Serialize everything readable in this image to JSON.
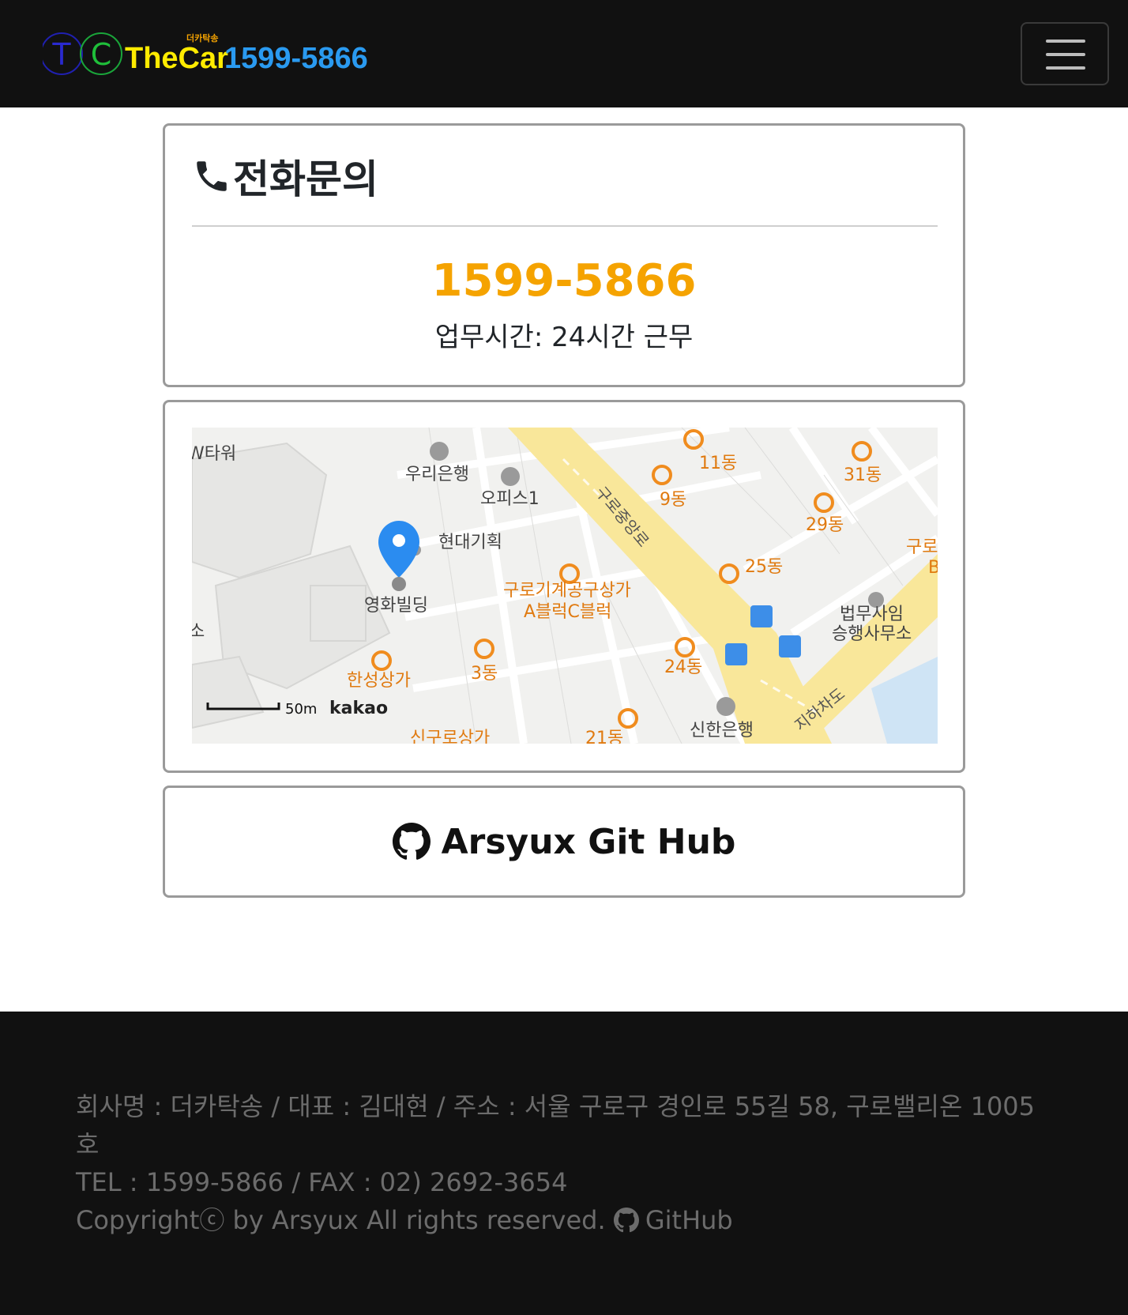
{
  "header": {
    "logo_letter_t": "T",
    "logo_letter_c": "C",
    "logo_small": "더카탁송",
    "logo_name": "TheCar",
    "logo_phone": "1599-5866",
    "menu_icon": "hamburger-icon"
  },
  "phone_card": {
    "title": "전화문의",
    "icon": "phone-icon",
    "number": "1599-5866",
    "hours": "업무시간: 24시간 근무"
  },
  "map": {
    "labels": {
      "w_tower": "W타워",
      "woori": "우리은행",
      "office1": "오피스1",
      "hyundai": "현대기획",
      "road_guro": "구로중앙로",
      "dong9": "9동",
      "dong11": "11동",
      "dong31": "31동",
      "dong29": "29동",
      "guro_edge": "구로",
      "b_edge": "B",
      "dong25": "25동",
      "younghwa": "영화빌딩",
      "mall_a": "구로기계공구상가",
      "mall_b": "A블럭C블럭",
      "law1": "법무사임",
      "law2": "승행사무소",
      "so_edge": "소",
      "hansung": "한성상가",
      "dong3": "3동",
      "dong24": "24동",
      "underpass": "지하차도",
      "shinhan": "신한은행",
      "dong21": "21동",
      "bottom_mall": "신구로상가",
      "scale": "50m",
      "provider": "kakao"
    },
    "colors": {
      "road": "#f9e79a",
      "poi": "#f08c1e",
      "pin": "#2b8cf0",
      "bus": "#3d8ee8"
    }
  },
  "git_card": {
    "label": "Arsyux Git Hub",
    "icon": "github-icon"
  },
  "footer": {
    "line1": "회사명 : 더카탁송 / 대표 : 김대현 / 주소 : 서울 구로구 경인로 55길 58, 구로밸리온 1005호",
    "line2": "TEL : 1599-5866 / FAX : 02) 2692-3654",
    "line3": "Copyrightⓒ by Arsyux All rights reserved.",
    "github_label": "GitHub"
  }
}
